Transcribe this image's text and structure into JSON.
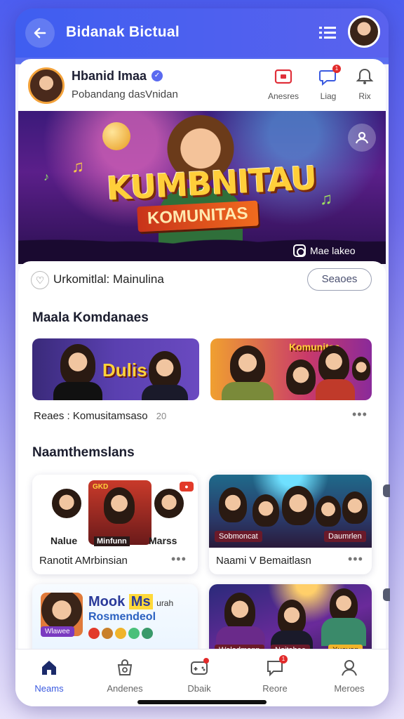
{
  "header": {
    "title": "Bidanak Bictual",
    "back_icon": "arrow-left-icon",
    "menu_icon": "grid-menu-icon"
  },
  "profile": {
    "name": "Hbanid Imaa",
    "subtitle": "Pobandang dasVnidan",
    "actions": [
      {
        "label": "Anesres",
        "icon": "video-icon"
      },
      {
        "label": "Liag",
        "icon": "chat-icon",
        "badge": "1"
      },
      {
        "label": "Rix",
        "icon": "bell-icon"
      }
    ]
  },
  "banner": {
    "title": "KUMBNITAU",
    "subtitle": "KOMUNITAS",
    "live_label": "Mae lakeo"
  },
  "section": {
    "heading": "Urkomitlal: Mainulina",
    "button": "Seaoes"
  },
  "featured": {
    "heading": "Maala Komdanaes",
    "thumb1_text": "Dulis",
    "thumb2_text": "Komunitas",
    "caption": "Reaes : Komusitamsaso",
    "caption_count": "20"
  },
  "recommend": {
    "heading": "Naamthemslans",
    "cards": [
      {
        "title": "Ranotit AMrbinsian",
        "left_label": "Nalue",
        "right_label": "Marss",
        "center_label": "Minfunn",
        "tag": "GKD"
      },
      {
        "title": "Naami V Bemaitlasn",
        "tag_left": "Sobmoncat",
        "tag_right": "Daumrlen"
      }
    ],
    "card3": {
      "title_a": "Mook",
      "title_b": "Ms",
      "title_c": "urah",
      "subtitle": "Rosmendeol",
      "tag": "Wlawee"
    },
    "card4": {
      "tag_left": "Weladmann",
      "tag_mid": "Noitabee",
      "tag_right": "Xuayan"
    }
  },
  "nav": {
    "items": [
      {
        "label": "Neams",
        "icon": "home-icon",
        "active": true
      },
      {
        "label": "Andenes",
        "icon": "shop-bag-icon"
      },
      {
        "label": "Dbaik",
        "icon": "gamepad-icon"
      },
      {
        "label": "Reore",
        "icon": "message-icon",
        "badge": "1"
      },
      {
        "label": "Meroes",
        "icon": "profile-icon"
      }
    ]
  },
  "colors": {
    "accent": "#3f5ef0",
    "badge": "#e22a2a",
    "banner_title": "#ffcf3a"
  }
}
